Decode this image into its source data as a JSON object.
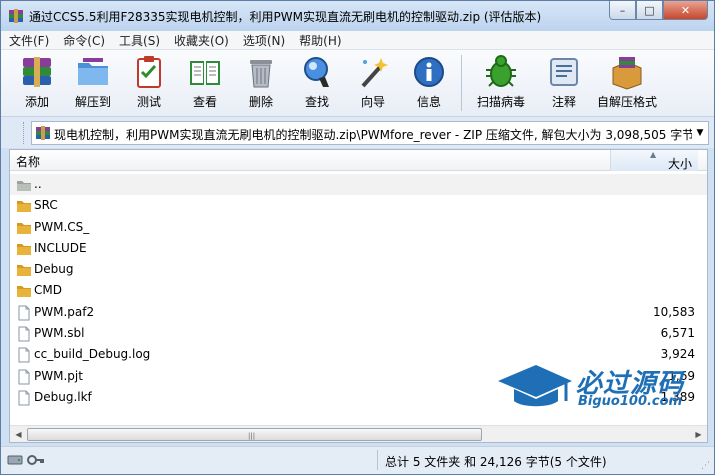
{
  "window": {
    "title": "通过CCS5.5利用F28335实现电机控制，利用PWM实现直流无刷电机的控制驱动.zip (评估版本)",
    "minimize": "–",
    "maximize": "□",
    "close": "✕"
  },
  "menu": [
    "文件(F)",
    "命令(C)",
    "工具(S)",
    "收藏夹(O)",
    "选项(N)",
    "帮助(H)"
  ],
  "toolbar": {
    "add": "添加",
    "extract": "解压到",
    "test": "测试",
    "view": "查看",
    "delete": "删除",
    "find": "查找",
    "wizard": "向导",
    "info": "信息",
    "virus": "扫描病毒",
    "comment": "注释",
    "sfx": "自解压格式"
  },
  "address": {
    "path": "现电机控制，利用PWM实现直流无刷电机的控制驱动.zip\\PWMfore_rever - ZIP 压缩文件, 解包大小为 3,098,505 字节"
  },
  "list": {
    "col_name": "名称",
    "col_size": "大小",
    "rows": [
      {
        "name": "..",
        "size": "",
        "type": "parent"
      },
      {
        "name": "SRC",
        "size": "",
        "type": "folder"
      },
      {
        "name": "PWM.CS_",
        "size": "",
        "type": "folder"
      },
      {
        "name": "INCLUDE",
        "size": "",
        "type": "folder"
      },
      {
        "name": "Debug",
        "size": "",
        "type": "folder"
      },
      {
        "name": "CMD",
        "size": "",
        "type": "folder"
      },
      {
        "name": "PWM.paf2",
        "size": "10,583",
        "type": "file"
      },
      {
        "name": "PWM.sbl",
        "size": "6,571",
        "type": "file"
      },
      {
        "name": "cc_build_Debug.log",
        "size": "3,924",
        "type": "file"
      },
      {
        "name": "PWM.pjt",
        "size": "1,69",
        "type": "file"
      },
      {
        "name": "Debug.lkf",
        "size": "1,389",
        "type": "file"
      }
    ]
  },
  "watermark": {
    "main": "必过源码",
    "sub": "Biguo100.com"
  },
  "status": {
    "summary": "总计 5 文件夹 和 24,126 字节(5 个文件)"
  },
  "colors": {
    "accent": "#1e6fb5",
    "folder": "#e8b33a"
  }
}
